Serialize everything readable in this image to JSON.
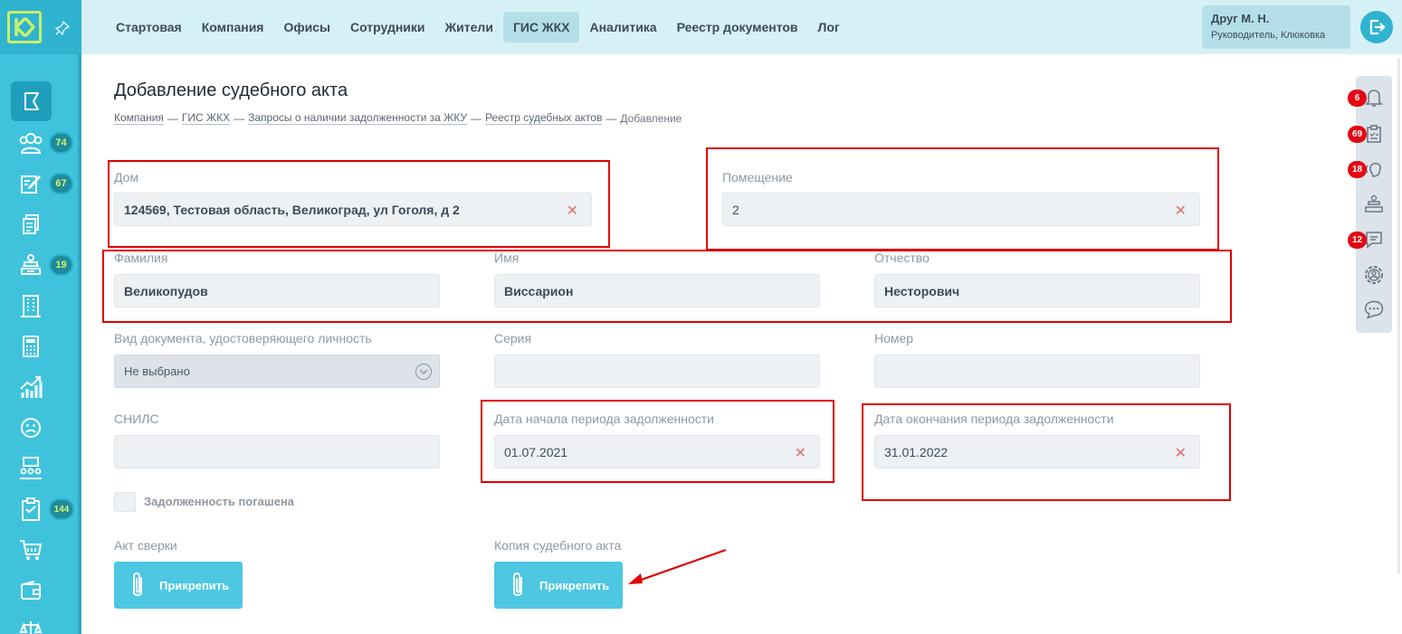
{
  "sidebar": {
    "logo_letter": "K",
    "badges": {
      "residents": "74",
      "requests": "67",
      "reception": "19",
      "tasks": "144"
    }
  },
  "header": {
    "menu": [
      "Стартовая",
      "Компания",
      "Офисы",
      "Сотрудники",
      "Жители",
      "ГИС ЖКХ",
      "Аналитика",
      "Реестр документов",
      "Лог"
    ],
    "active_menu": "ГИС ЖКХ",
    "user": {
      "name": "Друг М. Н.",
      "role": "Руководитель, Клюковка"
    }
  },
  "tools": {
    "badges": {
      "notifications": "6",
      "tasks": "69",
      "calls": "18",
      "messages": "12"
    }
  },
  "page": {
    "title": "Добавление судебного акта",
    "breadcrumbs": [
      "Компания",
      "ГИС ЖКХ",
      "Запросы о наличии задолженности за ЖКУ",
      "Реестр судебных актов"
    ],
    "breadcrumb_current": "Добавление"
  },
  "form": {
    "house": {
      "label": "Дом",
      "value": "124569, Тестовая область, Великоград, ул Гоголя, д 2"
    },
    "room": {
      "label": "Помещение",
      "value": "2"
    },
    "last_name": {
      "label": "Фамилия",
      "value": "Великопудов"
    },
    "first_name": {
      "label": "Имя",
      "value": "Виссарион"
    },
    "patronymic": {
      "label": "Отчество",
      "value": "Несторович"
    },
    "doc_type": {
      "label": "Вид документа, удостоверяющего личность",
      "value": "Не выбрано"
    },
    "series": {
      "label": "Серия",
      "value": ""
    },
    "number": {
      "label": "Номер",
      "value": ""
    },
    "snils": {
      "label": "СНИЛС",
      "value": ""
    },
    "date_start": {
      "label": "Дата начала периода задолженности",
      "value": "01.07.2021"
    },
    "date_end": {
      "label": "Дата окончания периода задолженности",
      "value": "31.01.2022"
    },
    "debt_paid": {
      "label": "Задолженность погашена",
      "checked": false
    },
    "reconciliation": {
      "label": "Акт сверки",
      "button": "Прикрепить"
    },
    "court_copy": {
      "label": "Копия судебного акта",
      "button": "Прикрепить"
    },
    "clear_symbol": "✕"
  }
}
